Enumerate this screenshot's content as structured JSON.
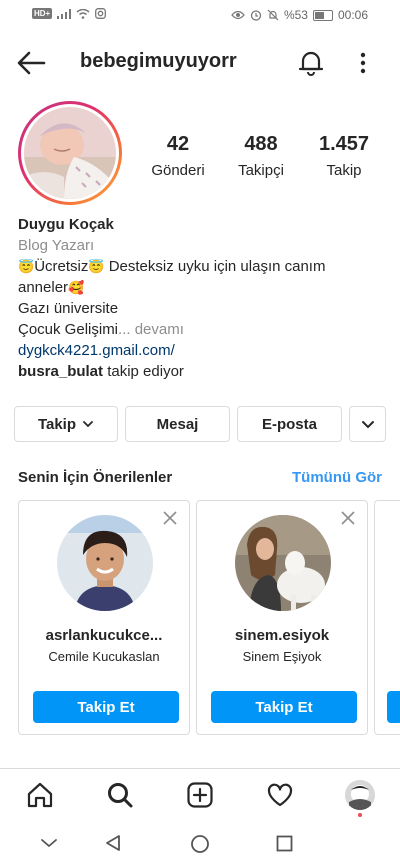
{
  "status_bar": {
    "left_badge": "HD+",
    "battery_pct": "%53",
    "time": "00:06"
  },
  "header": {
    "username": "bebegimuyuyorr"
  },
  "stats": [
    {
      "number": "42",
      "label": "Gönderi"
    },
    {
      "number": "488",
      "label": "Takipçi"
    },
    {
      "number": "1.457",
      "label": "Takip"
    }
  ],
  "bio": {
    "name": "Duygu Koçak",
    "category": "Blog Yazarı",
    "line1_text_a": "Ücretsiz",
    "line1_text_b": " Desteksiz uyku için ulaşın canım",
    "line2_text": "anneler",
    "line3_text": "Gazı üniversite",
    "line4_text": "Çocuk Gelişimi",
    "more_text": "... devamı",
    "link": "dygkck4221.gmail.com/",
    "followed_by_user": "busra_bulat",
    "followed_by_text": " takip ediyor",
    "emoji_smile_halo": "😇",
    "emoji_love": "🥰"
  },
  "actions": {
    "follow_label": "Takip",
    "message_label": "Mesaj",
    "email_label": "E-posta"
  },
  "suggestions": {
    "title": "Senin İçin Önerilenler",
    "see_all": "Tümünü Gör",
    "cards": [
      {
        "username": "asrlankucukce...",
        "name": "Cemile Kucukaslan",
        "button": "Takip Et"
      },
      {
        "username": "sinem.esiyok",
        "name": "Sinem Eşiyok",
        "button": "Takip Et"
      }
    ]
  },
  "colors": {
    "accent_blue": "#0095f6",
    "link_blue": "#3897f0",
    "notification_dot": "#ed4956"
  }
}
